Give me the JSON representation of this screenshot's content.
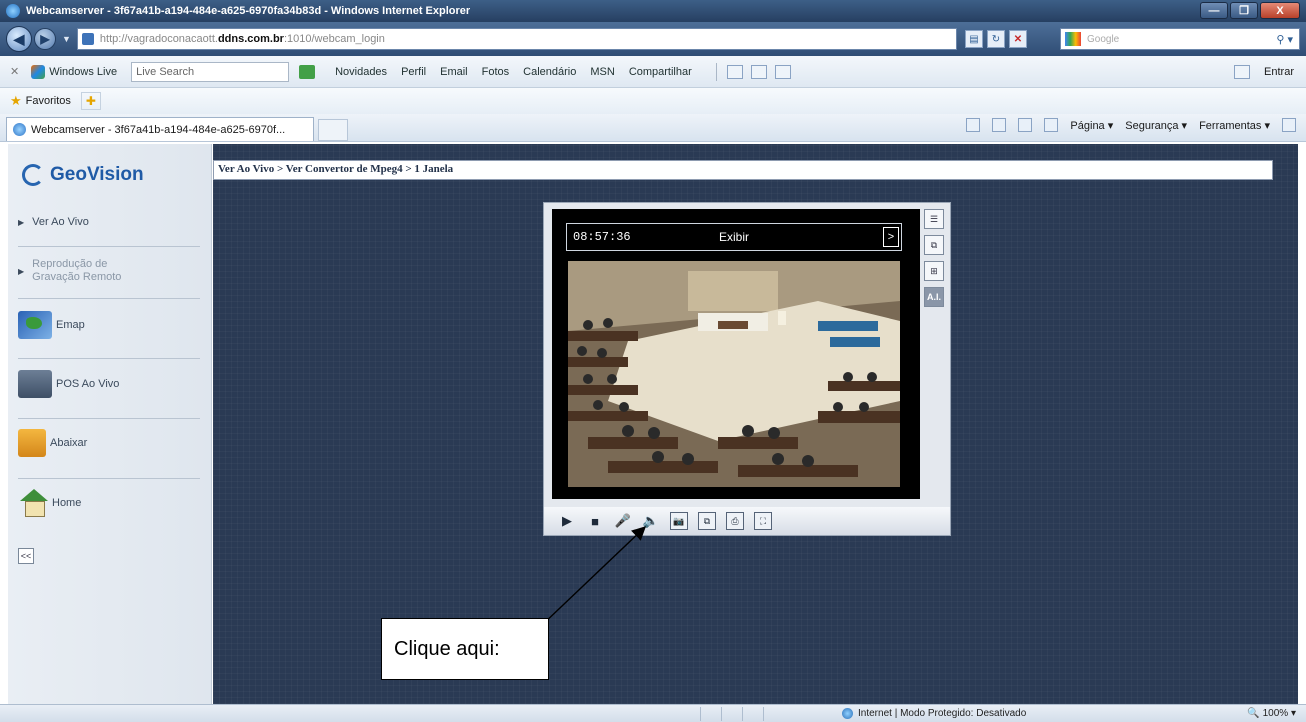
{
  "window": {
    "title": "Webcamserver - 3f67a41b-a194-484e-a625-6970fa34b83d - Windows Internet Explorer",
    "min_label": "—",
    "max_label": "❐",
    "close_label": "X"
  },
  "address": {
    "url_prefix": "http://vagradoconacaott.",
    "url_domain": "ddns.com.br",
    "url_suffix": ":1010/webcam_login",
    "search_placeholder": "Google"
  },
  "links_bar": {
    "windows_live": "Windows Live",
    "live_search": "Live Search",
    "items": [
      "Novidades",
      "Perfil",
      "Email",
      "Fotos",
      "Calendário",
      "MSN",
      "Compartilhar"
    ],
    "entrar": "Entrar"
  },
  "favorites": {
    "label": "Favoritos"
  },
  "tab": {
    "label": "Webcamserver - 3f67a41b-a194-484e-a625-6970f..."
  },
  "command_bar": {
    "pagina": "Página ▾",
    "seguranca": "Segurança ▾",
    "ferramentas": "Ferramentas ▾"
  },
  "sidebar": {
    "logo": "GeoVision",
    "ver_ao_vivo": "Ver Ao Vivo",
    "reproducao_1": "Reprodução de",
    "reproducao_2": "Gravação Remoto",
    "emap": "Emap",
    "pos_ao_vivo": "POS Ao Vivo",
    "abaixar": "Abaixar",
    "home": "Home",
    "collapse": "<<"
  },
  "breadcrumb": "Ver Ao Vivo > Ver Convertor de Mpeg4 > 1 Janela",
  "camera": {
    "time": "08:57:36",
    "label": "Exibir",
    "next": ">",
    "side_tool_ai": "A.I."
  },
  "callout": {
    "text": "Clique aqui:"
  },
  "status": {
    "zone": "Internet | Modo Protegido: Desativado",
    "zoom": "100%"
  }
}
